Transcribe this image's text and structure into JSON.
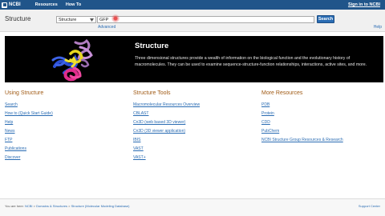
{
  "topbar": {
    "logo": "NCBI",
    "nav": [
      "Resources",
      "How To"
    ],
    "signin": "Sign in to NCBI"
  },
  "search": {
    "db_title": "Structure",
    "db_selected": "Structure",
    "query": "GFP",
    "button": "Search",
    "advanced": "Advanced",
    "help": "Help"
  },
  "banner": {
    "title": "Structure",
    "description": "Three dimensional structures provide a wealth of information on the biological function and the evolutionary history of macromolecules. They can be used to examine sequence-structure-function relationships, interactions, active sites, and more."
  },
  "columns": [
    {
      "heading": "Using Structure",
      "links": [
        "Search",
        "How to (Quick Start Guide)",
        "Help",
        "News",
        "FTP",
        "Publications",
        "Discover"
      ]
    },
    {
      "heading": "Structure Tools",
      "links": [
        "Macromolecular Resources Overview",
        "CBLAST",
        "Cn3D (web based 3D viewer)",
        "Cn3D (3D viewer application)",
        "IBIS",
        "VAST",
        "VAST+"
      ]
    },
    {
      "heading": "More Resources",
      "links": [
        "PDB",
        "Protein",
        "CDD",
        "PubChem",
        "NCBI Structure Group Resources & Research"
      ]
    }
  ],
  "footer": {
    "prefix": "You are here: ",
    "crumbs": [
      "NCBI",
      "Domains & Structures",
      "Structure (Molecular Modeling Database)"
    ],
    "support": "Support Center"
  },
  "colors": {
    "topbar": "#20558a",
    "link": "#2a6cb3",
    "heading": "#a05a14"
  },
  "icons": [
    "ncbi-logo-icon",
    "dropdown-arrow-icon",
    "protein-structure-image"
  ]
}
